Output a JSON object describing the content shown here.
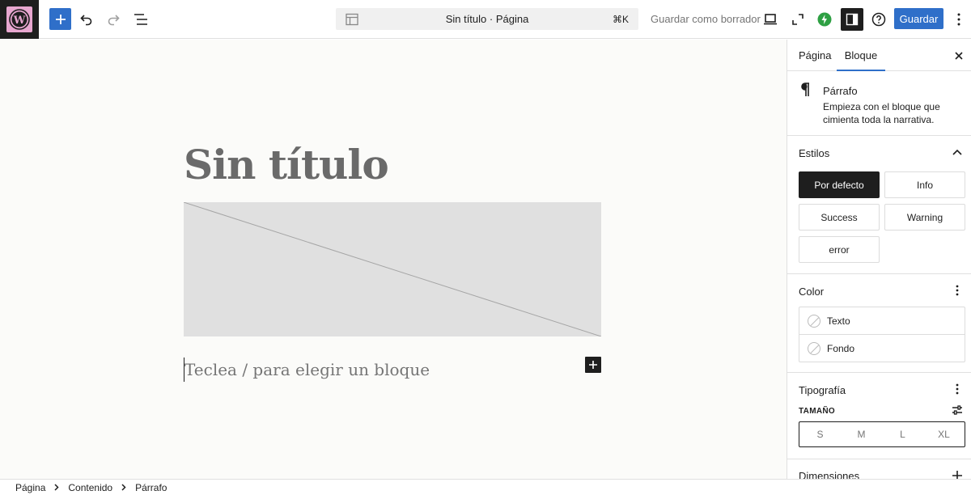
{
  "header": {
    "document_title": "Sin título · Página",
    "shortcut": "⌘K",
    "save_draft_label": "Guardar como borrador",
    "save_label": "Guardar"
  },
  "editor": {
    "post_title": "Sin título",
    "paragraph_placeholder": "Teclea / para elegir un bloque"
  },
  "sidebar": {
    "tabs": [
      {
        "label": "Página"
      },
      {
        "label": "Bloque"
      }
    ],
    "block": {
      "name": "Párrafo",
      "description": "Empieza con el bloque que cimienta toda la narrativa."
    },
    "styles": {
      "title": "Estilos",
      "options": [
        "Por defecto",
        "Info",
        "Success",
        "Warning",
        "error"
      ]
    },
    "color": {
      "title": "Color",
      "items": [
        "Texto",
        "Fondo"
      ]
    },
    "typography": {
      "title": "Tipografía",
      "size_label": "TAMAÑO",
      "sizes": [
        "S",
        "M",
        "L",
        "XL"
      ]
    },
    "dimensions": {
      "title": "Dimensiones"
    }
  },
  "breadcrumb": [
    "Página",
    "Contenido",
    "Párrafo"
  ],
  "colors": {
    "accent": "#2f6fc9",
    "dark": "#1e1e1e",
    "logo_bg": "#e8a7d0"
  }
}
